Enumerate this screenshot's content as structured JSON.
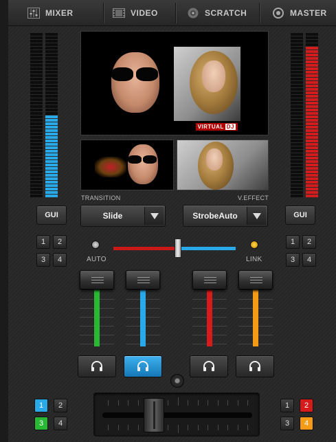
{
  "tabs": [
    {
      "label": "MIXER",
      "icon": "mixer-icon"
    },
    {
      "label": "VIDEO",
      "icon": "film-icon"
    },
    {
      "label": "SCRATCH",
      "icon": "vinyl-icon"
    },
    {
      "label": "MASTER",
      "icon": "master-target-icon"
    }
  ],
  "video": {
    "logo_text": "VIRTUAL",
    "logo_badge": "DJ",
    "transition_label": "TRANSITION",
    "effect_label": "V.EFFECT",
    "transition_value": "Slide",
    "effect_value": "StrobeAuto"
  },
  "gui": {
    "left": "GUI",
    "right": "GUI"
  },
  "deck_selectors": {
    "left": [
      "1",
      "2",
      "3",
      "4"
    ],
    "right": [
      "1",
      "2",
      "3",
      "4"
    ]
  },
  "crossfader_top": {
    "auto_label": "AUTO",
    "link_label": "LINK",
    "position": 0.52
  },
  "channel_colors": [
    "#28b833",
    "#2aa9e8",
    "#d51c1c",
    "#f39a17"
  ],
  "pfl_active_channel": 2,
  "bottom_decks": {
    "left": [
      "1",
      "2",
      "3",
      "4"
    ],
    "right": [
      "1",
      "2",
      "3",
      "4"
    ],
    "left_active": {
      "1": "#2aa9e8",
      "3": "#28b833"
    },
    "right_active": {
      "2": "#d51c1c",
      "4": "#f39a17"
    }
  },
  "vu": {
    "left_level": 0.5,
    "right_level": 0.92
  },
  "colors": {
    "accent_blue": "#2aa9e8",
    "accent_red": "#d51c1c",
    "accent_green": "#28b833",
    "accent_orange": "#f39a17",
    "led_yellow": "#f4b400"
  }
}
